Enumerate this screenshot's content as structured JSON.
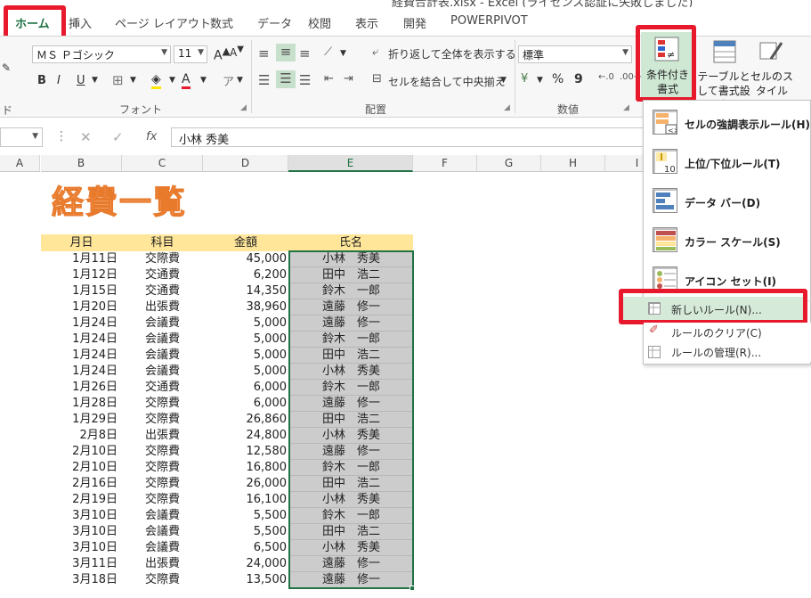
{
  "window": {
    "title": "経費合計表.xlsx - Excel (ライセンス認証に失敗しました)"
  },
  "tabs": [
    "ホーム",
    "挿入",
    "ページ レイアウト",
    "数式",
    "データ",
    "校閲",
    "表示",
    "開発",
    "POWERPIVOT"
  ],
  "ribbon": {
    "font_name": "ＭＳ Ｐゴシック",
    "font_size": "11",
    "wrap_text": "折り返して全体を表示する",
    "merge_center": "セルを結合して中央揃え",
    "number_format": "標準",
    "percent": "%",
    "comma": "9",
    "conditional_format": "条件付き書式",
    "format_table": "テーブルとして書式設定",
    "cell_styles": "セルのスタイル",
    "groups": {
      "font": "フォント",
      "alignment": "配置",
      "number": "数値"
    },
    "left_labels": {
      "k": "ド"
    }
  },
  "formula_bar": {
    "fx": "fx",
    "value": "小林 秀美"
  },
  "columns": [
    "A",
    "B",
    "C",
    "D",
    "E",
    "F",
    "G",
    "H",
    "I"
  ],
  "sheet": {
    "title": "経費一覧",
    "headers": [
      "月日",
      "科目",
      "金額",
      "氏名"
    ],
    "rows": [
      [
        "1月11日",
        "交際費",
        "45,000",
        "小林　秀美"
      ],
      [
        "1月12日",
        "交通費",
        "6,200",
        "田中　浩二"
      ],
      [
        "1月15日",
        "交通費",
        "14,350",
        "鈴木　一郎"
      ],
      [
        "1月20日",
        "出張費",
        "38,960",
        "遠藤　修一"
      ],
      [
        "1月24日",
        "会議費",
        "5,000",
        "遠藤　修一"
      ],
      [
        "1月24日",
        "会議費",
        "5,000",
        "鈴木　一郎"
      ],
      [
        "1月24日",
        "会議費",
        "5,000",
        "田中　浩二"
      ],
      [
        "1月24日",
        "会議費",
        "5,000",
        "小林　秀美"
      ],
      [
        "1月26日",
        "交通費",
        "6,000",
        "鈴木　一郎"
      ],
      [
        "1月28日",
        "交際費",
        "6,000",
        "遠藤　修一"
      ],
      [
        "1月29日",
        "交際費",
        "26,860",
        "田中　浩二"
      ],
      [
        "2月8日",
        "出張費",
        "24,800",
        "小林　秀美"
      ],
      [
        "2月10日",
        "交際費",
        "12,580",
        "遠藤　修一"
      ],
      [
        "2月10日",
        "交際費",
        "16,800",
        "鈴木　一郎"
      ],
      [
        "2月16日",
        "交際費",
        "26,000",
        "田中　浩二"
      ],
      [
        "2月19日",
        "交際費",
        "16,100",
        "小林　秀美"
      ],
      [
        "3月10日",
        "会議費",
        "5,500",
        "鈴木　一郎"
      ],
      [
        "3月10日",
        "会議費",
        "5,500",
        "田中　浩二"
      ],
      [
        "3月10日",
        "会議費",
        "6,500",
        "小林　秀美"
      ],
      [
        "3月11日",
        "出張費",
        "24,000",
        "遠藤　修一"
      ],
      [
        "3月18日",
        "交際費",
        "13,500",
        "遠藤　修一"
      ]
    ]
  },
  "cf_menu": {
    "items": [
      "セルの強調表示ルール(H)",
      "上位/下位ルール(T)",
      "データ バー(D)",
      "カラー スケール(S)",
      "アイコン セット(I)"
    ],
    "small_items": [
      "新しいルール(N)...",
      "ルールのクリア(C)",
      "ルールの管理(R)..."
    ]
  },
  "colors": {
    "accent": "#217346",
    "highlight": "#e8192c",
    "header_fill": "#ffe699",
    "title": "#f8a068"
  }
}
